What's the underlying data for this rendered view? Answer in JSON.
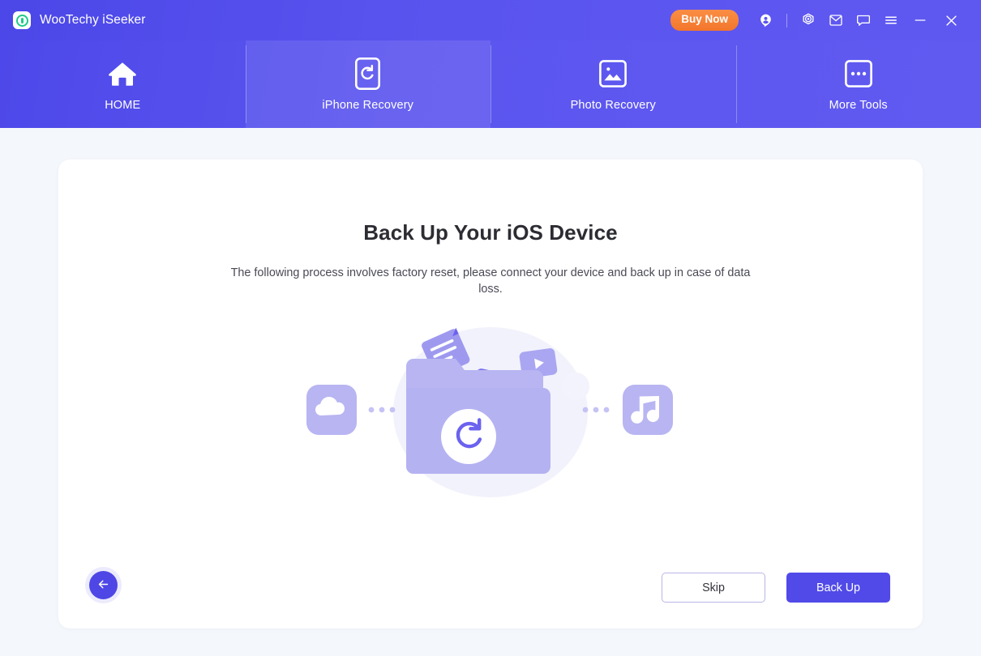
{
  "titlebar": {
    "app_title": "WooTechy iSeeker",
    "logo_icon": "iseeker-logo-icon",
    "buy_now_label": "Buy Now",
    "icons": [
      {
        "name": "account-icon",
        "label": "Account"
      },
      {
        "name": "target-settings-icon",
        "label": "Settings"
      },
      {
        "name": "mail-icon",
        "label": "Mail"
      },
      {
        "name": "feedback-chat-icon",
        "label": "Feedback"
      },
      {
        "name": "menu-icon",
        "label": "Menu"
      },
      {
        "name": "minimize-icon",
        "label": "Minimize"
      },
      {
        "name": "close-icon",
        "label": "Close"
      }
    ]
  },
  "nav": {
    "tabs": [
      {
        "label": "HOME",
        "icon": "home-icon",
        "active": false
      },
      {
        "label": "iPhone Recovery",
        "icon": "phone-refresh-icon",
        "active": true
      },
      {
        "label": "Photo Recovery",
        "icon": "photo-image-icon",
        "active": false
      },
      {
        "label": "More Tools",
        "icon": "more-dots-icon",
        "active": false
      }
    ]
  },
  "main": {
    "headline": "Back Up Your iOS Device",
    "subtext": "The following process involves factory reset, please connect your device and back up in case of data loss.",
    "illustration": {
      "name": "backup-folder-illustration",
      "elements": [
        "cloud-icon",
        "dotted-connector-left",
        "folder-icon",
        "refresh-badge-icon",
        "document-icon",
        "video-play-icon",
        "photo-icon",
        "dotted-connector-right",
        "music-note-icon"
      ]
    }
  },
  "footer": {
    "back_label": "Back",
    "back_icon": "arrow-left-icon",
    "skip_label": "Skip",
    "backup_label": "Back Up"
  },
  "colors": {
    "header_gradient_start": "#4b47e8",
    "header_gradient_end": "#615af1",
    "accent_primary": "#514ae8",
    "buy_now_orange": "#f2762c",
    "logo_green": "#1fc98a",
    "page_background": "#f4f7fb",
    "card_background": "#ffffff",
    "illustration_light": "#b8b5f2",
    "illustration_dark": "#6b62ef"
  }
}
